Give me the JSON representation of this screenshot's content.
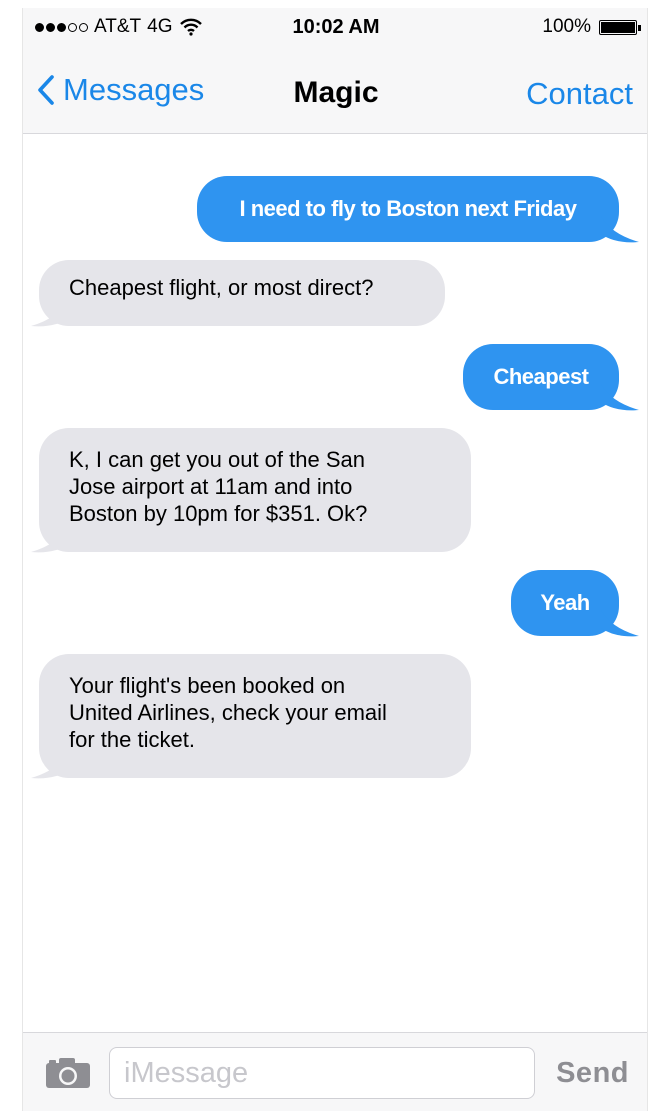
{
  "status_bar": {
    "carrier": "AT&T",
    "network": "4G",
    "signal_bars_filled": 3,
    "signal_bars_total": 5,
    "time": "10:02 AM",
    "battery_percent": "100%",
    "battery_level": 1.0
  },
  "nav": {
    "back_label": "Messages",
    "title": "Magic",
    "contact_label": "Contact"
  },
  "messages": [
    {
      "from": "me",
      "text": "I need to fly to Boston next Friday"
    },
    {
      "from": "them",
      "lines": [
        "Cheapest flight, or most direct?"
      ]
    },
    {
      "from": "me",
      "text": "Cheapest"
    },
    {
      "from": "them",
      "lines": [
        "K, I can get you out of the San",
        "Jose airport at 11am and into",
        "Boston by 10pm for $351. Ok?"
      ]
    },
    {
      "from": "me",
      "text": "Yeah"
    },
    {
      "from": "them",
      "lines": [
        "Your flight's been booked on",
        "United Airlines, check your email",
        "for the ticket."
      ]
    }
  ],
  "input_bar": {
    "placeholder": "iMessage",
    "value": "",
    "send_label": "Send"
  },
  "icons": {
    "back": "chevron-left-icon",
    "wifi": "wifi-icon",
    "battery": "battery-icon",
    "camera": "camera-icon"
  },
  "colors": {
    "accent": "#1a87e8",
    "outgoing_bubble": "#2f94f0",
    "incoming_bubble": "#e5e5ea",
    "send_disabled": "#8e8e93"
  }
}
